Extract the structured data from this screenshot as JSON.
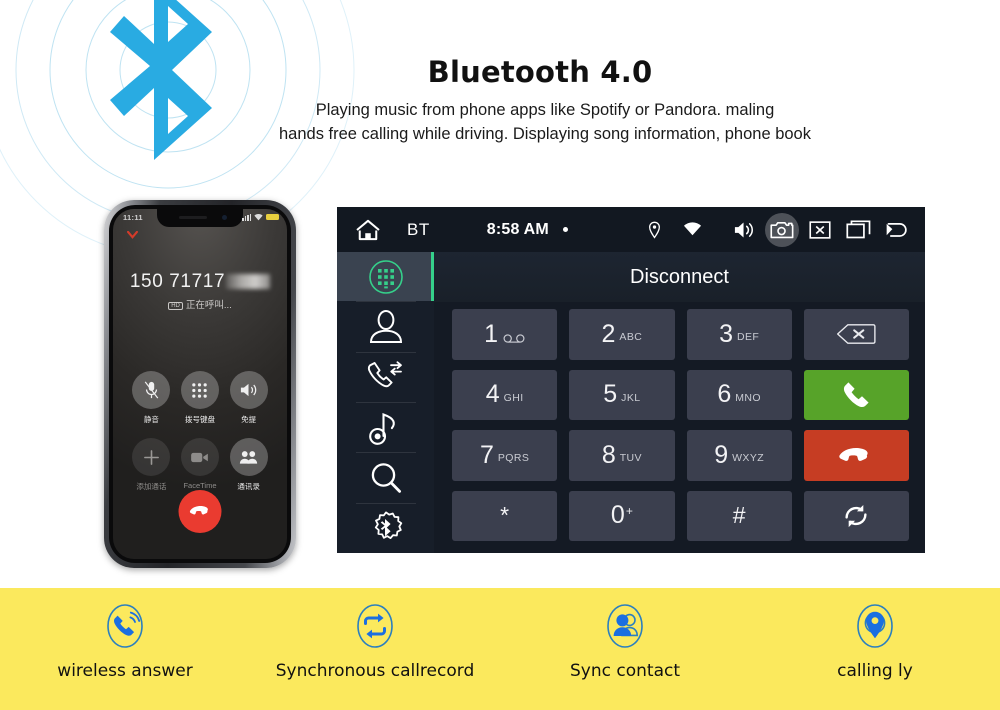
{
  "hero": {
    "title": "Bluetooth 4.0",
    "subtitle_line1": "Playing music from phone apps like Spotify or Pandora. maling",
    "subtitle_line2": "hands free calling while driving. Displaying  song information, phone book",
    "logo_color": "#29abe2",
    "ring_color": "#bfe3f2"
  },
  "phone": {
    "status_time": "11:11",
    "number": "150 71717",
    "call_status": "正在呼叫...",
    "hd_badge": "HD",
    "buttons": [
      {
        "label": "静音",
        "icon": "mute-icon",
        "dim": false
      },
      {
        "label": "拨号键盘",
        "icon": "keypad-icon",
        "dim": false
      },
      {
        "label": "免提",
        "icon": "speaker-icon",
        "dim": false
      },
      {
        "label": "添加通话",
        "icon": "add-call-icon",
        "dim": true
      },
      {
        "label": "FaceTime",
        "icon": "facetime-icon",
        "dim": true
      },
      {
        "label": "通讯录",
        "icon": "contacts-icon",
        "dim": false
      }
    ],
    "end_call_icon": "end-call-icon",
    "end_call_color": "#ea3b30"
  },
  "head_unit": {
    "status_bar": {
      "home_icon": "home-icon",
      "source_label": "BT",
      "clock": "8:58 AM",
      "icons": [
        "location-icon",
        "wifi-icon",
        "volume-icon",
        "camera-icon",
        "close-icon",
        "recents-icon",
        "back-icon"
      ],
      "highlighted_icon": "camera-icon"
    },
    "sidebar": [
      {
        "name": "dialpad",
        "icon": "dialpad-icon",
        "active": true
      },
      {
        "name": "contacts",
        "icon": "contact-icon",
        "active": false
      },
      {
        "name": "call-log",
        "icon": "call-log-icon",
        "active": false
      },
      {
        "name": "music",
        "icon": "music-note-icon",
        "active": false
      },
      {
        "name": "search",
        "icon": "search-icon",
        "active": false
      },
      {
        "name": "bluetooth-settings",
        "icon": "bluetooth-gear-icon",
        "active": false
      }
    ],
    "title": "Disconnect",
    "accent_color": "#35d08a",
    "keypad": [
      {
        "num": "1",
        "sub": "",
        "icon": "voicemail-icon",
        "type": "digit"
      },
      {
        "num": "2",
        "sub": "ABC",
        "type": "digit"
      },
      {
        "num": "3",
        "sub": "DEF",
        "type": "digit"
      },
      {
        "num": "",
        "sub": "",
        "icon": "backspace-icon",
        "type": "action"
      },
      {
        "num": "4",
        "sub": "GHI",
        "type": "digit"
      },
      {
        "num": "5",
        "sub": "JKL",
        "type": "digit"
      },
      {
        "num": "6",
        "sub": "MNO",
        "type": "digit"
      },
      {
        "num": "",
        "sub": "",
        "icon": "call-icon",
        "type": "call",
        "color": "#57a329"
      },
      {
        "num": "7",
        "sub": "PQRS",
        "type": "digit"
      },
      {
        "num": "8",
        "sub": "TUV",
        "type": "digit"
      },
      {
        "num": "9",
        "sub": "WXYZ",
        "type": "digit"
      },
      {
        "num": "",
        "sub": "",
        "icon": "hangup-icon",
        "type": "hangup",
        "color": "#c63d23"
      },
      {
        "num": "*",
        "sub": "",
        "type": "symbol"
      },
      {
        "num": "0",
        "sub": "",
        "sup": "+",
        "type": "digit"
      },
      {
        "num": "#",
        "sub": "",
        "type": "symbol"
      },
      {
        "num": "",
        "sub": "",
        "icon": "refresh-icon",
        "type": "action"
      }
    ]
  },
  "features": {
    "background_color": "#fbe95d",
    "icon_color": "#1b6fe0",
    "items": [
      {
        "label": "wireless answer",
        "icon": "wireless-answer-icon"
      },
      {
        "label": "Synchronous callrecord",
        "icon": "sync-callrecord-icon"
      },
      {
        "label": "Sync contact",
        "icon": "sync-contact-icon"
      },
      {
        "label": "calling ly",
        "icon": "calling-location-icon"
      }
    ]
  }
}
